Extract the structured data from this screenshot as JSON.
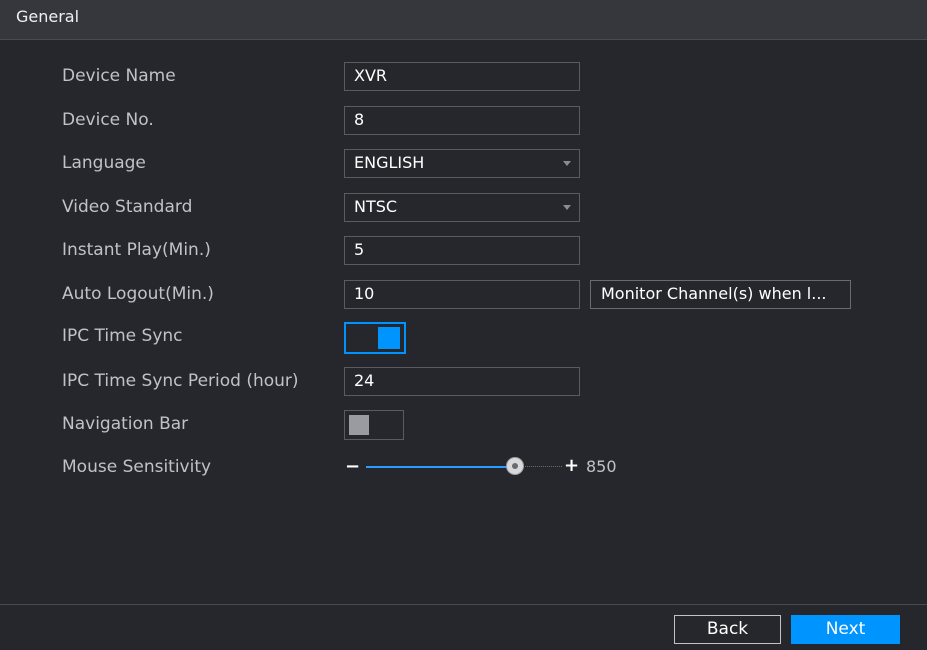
{
  "header": {
    "title": "General"
  },
  "form": {
    "device_name": {
      "label": "Device Name",
      "value": "XVR"
    },
    "device_no": {
      "label": "Device No.",
      "value": "8"
    },
    "language": {
      "label": "Language",
      "value": "ENGLISH"
    },
    "video_standard": {
      "label": "Video Standard",
      "value": "NTSC"
    },
    "instant_play": {
      "label": "Instant Play(Min.)",
      "value": "5"
    },
    "auto_logout": {
      "label": "Auto Logout(Min.)",
      "value": "10",
      "button_label": "Monitor Channel(s) when l..."
    },
    "ipc_time_sync": {
      "label": "IPC Time Sync",
      "enabled": true
    },
    "ipc_time_sync_period": {
      "label": "IPC Time Sync Period (hour)",
      "value": "24"
    },
    "navigation_bar": {
      "label": "Navigation Bar",
      "enabled": false
    },
    "mouse_sensitivity": {
      "label": "Mouse Sensitivity",
      "minus": "−",
      "plus": "+",
      "value": "850",
      "level": 0.73
    }
  },
  "footer": {
    "back_label": "Back",
    "next_label": "Next"
  },
  "colors": {
    "accent": "#0094ff",
    "background": "#26272d",
    "header": "#36373d"
  }
}
